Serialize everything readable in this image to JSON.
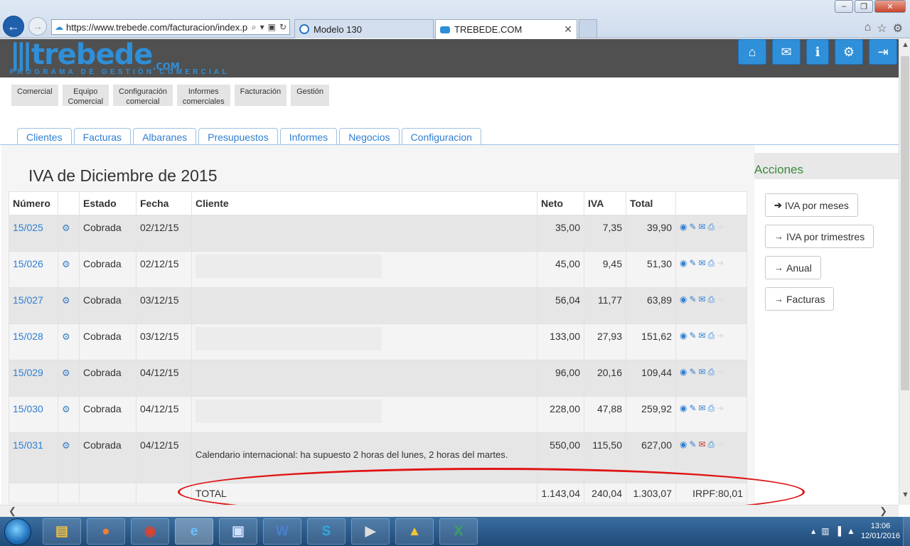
{
  "browser": {
    "url": "https://www.trebede.com/facturacion/index.p",
    "tabs": [
      {
        "label": "Modelo 130"
      },
      {
        "label": "TREBEDE.COM",
        "close": "✕"
      }
    ]
  },
  "site": {
    "logo_text": "trebede",
    "logo_suffix": ".COM",
    "logo_tagline": "PROGRAMA DE GESTIÓN COMERCIAL",
    "header_icons": [
      "home-icon",
      "envelope-icon",
      "info-icon",
      "gear-icon",
      "logout-icon"
    ],
    "main_menu": [
      {
        "line1": "Comercial",
        "line2": ""
      },
      {
        "line1": "Equipo",
        "line2": "Comercial"
      },
      {
        "line1": "Configuración",
        "line2": "comercial"
      },
      {
        "line1": "Informes",
        "line2": "comerciales"
      },
      {
        "line1": "Facturación",
        "line2": ""
      },
      {
        "line1": "Gestión",
        "line2": ""
      }
    ],
    "sub_tabs": [
      "Clientes",
      "Facturas",
      "Albaranes",
      "Presupuestos",
      "Informes",
      "Negocios",
      "Configuracion"
    ]
  },
  "page": {
    "title": "IVA de Diciembre de 2015"
  },
  "table": {
    "headers": {
      "numero": "Número",
      "estado": "Estado",
      "fecha": "Fecha",
      "cliente": "Cliente",
      "neto": "Neto",
      "iva": "IVA",
      "total": "Total"
    },
    "rows": [
      {
        "numero": "15/025",
        "estado": "Cobrada",
        "fecha": "02/12/15",
        "neto": "35,00",
        "iva": "7,35",
        "total": "39,90"
      },
      {
        "numero": "15/026",
        "estado": "Cobrada",
        "fecha": "02/12/15",
        "neto": "45,00",
        "iva": "9,45",
        "total": "51,30"
      },
      {
        "numero": "15/027",
        "estado": "Cobrada",
        "fecha": "03/12/15",
        "neto": "56,04",
        "iva": "11,77",
        "total": "63,89"
      },
      {
        "numero": "15/028",
        "estado": "Cobrada",
        "fecha": "03/12/15",
        "neto": "133,00",
        "iva": "27,93",
        "total": "151,62"
      },
      {
        "numero": "15/029",
        "estado": "Cobrada",
        "fecha": "04/12/15",
        "neto": "96,00",
        "iva": "20,16",
        "total": "109,44"
      },
      {
        "numero": "15/030",
        "estado": "Cobrada",
        "fecha": "04/12/15",
        "neto": "228,00",
        "iva": "47,88",
        "total": "259,92"
      },
      {
        "numero": "15/031",
        "estado": "Cobrada",
        "fecha": "04/12/15",
        "cliente_note": "Calendario internacional: ha supuesto 2 horas del lunes, 2 horas del martes.",
        "neto": "550,00",
        "iva": "115,50",
        "total": "627,00"
      }
    ],
    "total": {
      "label": "TOTAL",
      "neto": "1.143,04",
      "iva": "240,04",
      "total": "1.303,07",
      "irpf": "IRPF:80,01"
    }
  },
  "side_panel": {
    "title": "Acciones",
    "buttons": [
      "IVA por meses",
      "IVA por trimestres",
      "Anual",
      "Facturas"
    ]
  },
  "taskbar": {
    "time": "13:06",
    "date": "12/01/2016"
  }
}
